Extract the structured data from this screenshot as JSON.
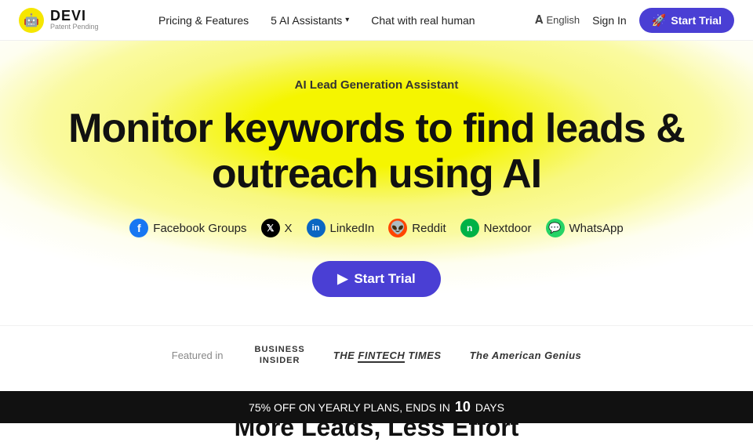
{
  "brand": {
    "icon": "🤖",
    "name": "DEVI",
    "patent": "Patent Pending"
  },
  "nav": {
    "links": [
      {
        "label": "Pricing & Features",
        "has_dropdown": false
      },
      {
        "label": "5 AI Assistants",
        "has_dropdown": true
      },
      {
        "label": "Chat with real human",
        "has_dropdown": false
      }
    ],
    "language": "English",
    "signin": "Sign In",
    "trial_btn": "Start Trial"
  },
  "hero": {
    "subtitle": "AI Lead Generation Assistant",
    "title_line1": "Monitor keywords to find leads &",
    "title_line2": "outreach using AI",
    "platforms": [
      {
        "name": "Facebook Groups",
        "icon_type": "fb",
        "icon_label": "f"
      },
      {
        "name": "X",
        "icon_type": "x",
        "icon_label": "𝕏"
      },
      {
        "name": "LinkedIn",
        "icon_type": "li",
        "icon_label": "in"
      },
      {
        "name": "Reddit",
        "icon_type": "reddit",
        "icon_label": "●"
      },
      {
        "name": "Nextdoor",
        "icon_type": "nextdoor",
        "icon_label": "n"
      },
      {
        "name": "WhatsApp",
        "icon_type": "whatsapp",
        "icon_label": "✓"
      }
    ],
    "trial_btn": "Start Trial"
  },
  "featured": {
    "label": "Featured in",
    "logos": [
      {
        "text": "BUSINESS\nINSIDER",
        "type": "bi"
      },
      {
        "text": "THE FINTECH TIMES",
        "type": "ft"
      },
      {
        "text": "The American Genius",
        "type": "ag"
      }
    ]
  },
  "more_leads": {
    "title": "More Leads, Less Effort"
  },
  "banner": {
    "text_prefix": "75% OFF ON YEARLY PLANS, ENDS IN",
    "days_count": "10",
    "text_suffix": "DAYS"
  }
}
